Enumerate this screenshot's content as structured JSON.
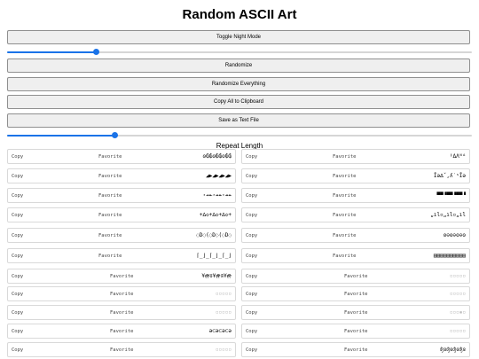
{
  "title": "Random ASCII Art",
  "buttons": {
    "toggle_night": "Toggle Night Mode",
    "randomize": "Randomize",
    "randomize_everything": "Randomize Everything",
    "copy_all": "Copy All to Clipboard",
    "save_text": "Save as Text File"
  },
  "sliders": {
    "first_value_fraction": 0.19,
    "repeat_value_fraction": 0.23
  },
  "repeat_label": "Repeat Length",
  "accent_color": "#1a73e8",
  "items": [
    {
      "copy": "Copy",
      "favorite": "Favorite",
      "art": "ʘ₲₲ʘ₲₲ʘ₲₲"
    },
    {
      "copy": "Copy",
      "favorite": "Favorite",
      "art": "ꞋΔΛᴺᴬ"
    },
    {
      "copy": "Copy",
      "favorite": "Favorite",
      "art": "◢▶◢▶◢▶◢▶"
    },
    {
      "copy": "Copy",
      "favorite": "Favorite",
      "art": "Ĭə∆ˇ,ʎ˙ˢĬə"
    },
    {
      "copy": "Copy",
      "favorite": "Favorite",
      "art": "⋆↠↞⋆↠↞⋆↠↞"
    },
    {
      "copy": "Copy",
      "favorite": "Favorite",
      "art": "▀▀▝▀▀▝▀▀▝"
    },
    {
      "copy": "Copy",
      "favorite": "Favorite",
      "art": "+∆◇+∆◇+∆◇+"
    },
    {
      "copy": "Copy",
      "favorite": "Favorite",
      "art": "„ıl▫„ıl▫„ıl"
    },
    {
      "copy": "Copy",
      "favorite": "Favorite",
      "art": "◌D◌(◌D◌(◌D◌"
    },
    {
      "copy": "Copy",
      "favorite": "Favorite",
      "art": "ʘ⊖ʘ⊖ʘ⊖ʘ"
    },
    {
      "copy": "Copy",
      "favorite": "Favorite",
      "art": "⌈_⌋_⌈_⌋_⌈_⌋"
    },
    {
      "copy": "Copy",
      "favorite": "Favorite",
      "art": "▤▤▤▤▤▤▤▤▤▤"
    },
    {
      "copy": "Copy",
      "favorite": "Favorite",
      "art": "¥፼ʬ¥፼ʬ¥፼"
    },
    {
      "copy": "Copy",
      "favorite": "Favorite",
      "art": "▫▫▫▫▫"
    },
    {
      "copy": "Copy",
      "favorite": "Favorite",
      "art": "▫▫▫▫▫"
    },
    {
      "copy": "Copy",
      "favorite": "Favorite",
      "art": "▫▫▫▫▫"
    },
    {
      "copy": "Copy",
      "favorite": "Favorite",
      "art": "▫▫▫▫▫"
    },
    {
      "copy": "Copy",
      "favorite": "Favorite",
      "art": "▫▫▫▪▫"
    },
    {
      "copy": "Copy",
      "favorite": "Favorite",
      "art": "ǝ⊂ǝ⊂ǝ⊂ǝ"
    },
    {
      "copy": "Copy",
      "favorite": "Favorite",
      "art": "▫▫▫▫▫"
    },
    {
      "copy": "Copy",
      "favorite": "Favorite",
      "art": "▫▫▫▫▫"
    },
    {
      "copy": "Copy",
      "favorite": "Favorite",
      "art": "ʤɞʤɞʤɞʤɞ"
    }
  ]
}
